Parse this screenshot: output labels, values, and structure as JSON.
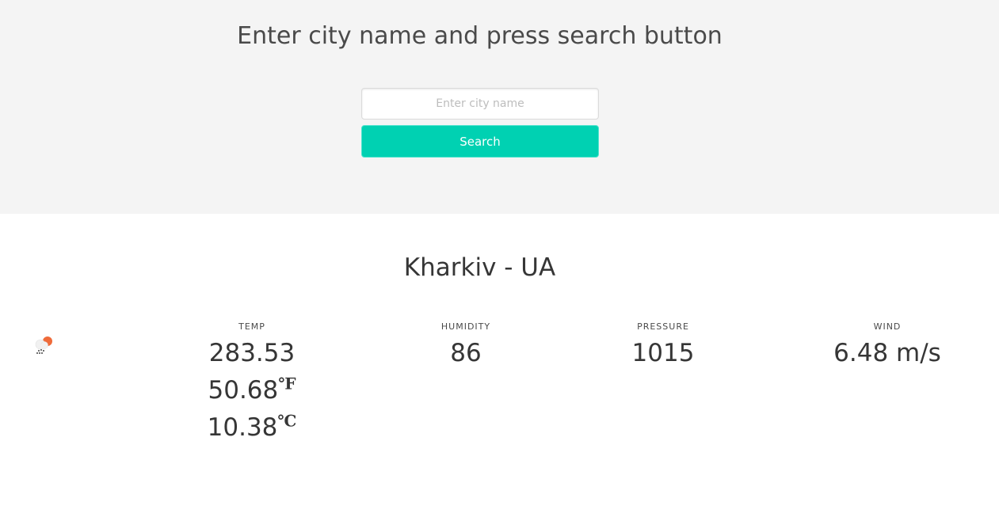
{
  "header": {
    "title": "Enter city name and press search button",
    "input_placeholder": "Enter city name",
    "input_value": "",
    "search_label": "Search"
  },
  "location": {
    "title": "Kharkiv - UA"
  },
  "weather": {
    "icon": "rain-cloud-sun-icon",
    "temp": {
      "label": "TEMP",
      "kelvin": "283.53",
      "fahrenheit": "50.68",
      "fahrenheit_unit": "℉",
      "celsius": "10.38",
      "celsius_unit": "℃"
    },
    "humidity": {
      "label": "HUMIDITY",
      "value": "86"
    },
    "pressure": {
      "label": "PRESSURE",
      "value": "1015"
    },
    "wind": {
      "label": "WIND",
      "value": "6.48 m/s"
    }
  },
  "colors": {
    "accent": "#00d1b2",
    "hero_background": "#f4f4f4",
    "text": "#363636"
  }
}
